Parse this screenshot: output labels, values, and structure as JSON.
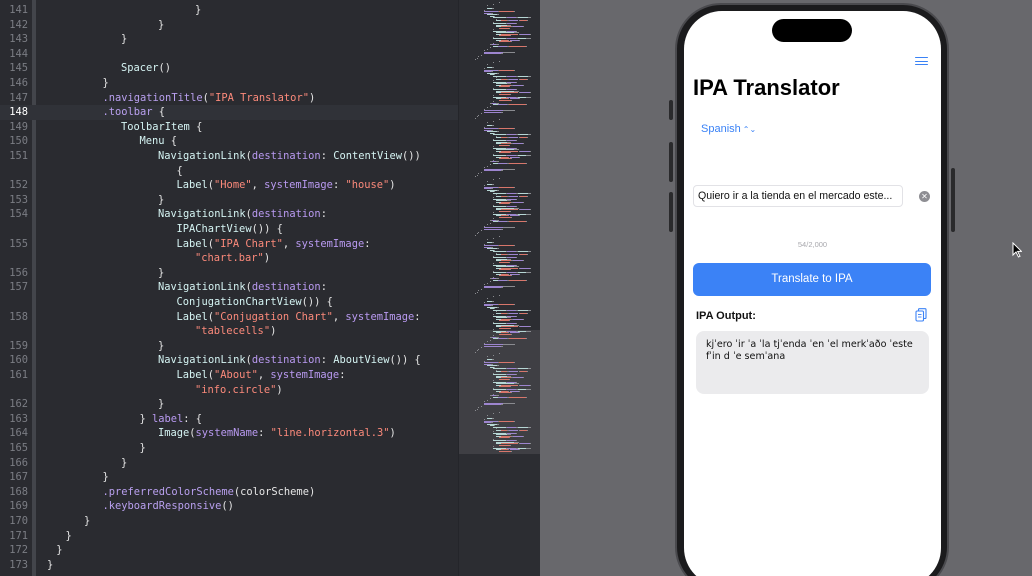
{
  "editor": {
    "current_line": 148,
    "lines": [
      {
        "num": "141",
        "indent": 8,
        "tokens": [
          {
            "t": "}",
            "c": "plain"
          }
        ]
      },
      {
        "num": "142",
        "indent": 6,
        "tokens": [
          {
            "t": "}",
            "c": "plain"
          }
        ]
      },
      {
        "num": "143",
        "indent": 4,
        "tokens": [
          {
            "t": "}",
            "c": "plain"
          }
        ]
      },
      {
        "num": "144",
        "indent": 0,
        "tokens": []
      },
      {
        "num": "145",
        "indent": 4,
        "tokens": [
          {
            "t": "Spacer",
            "c": "type"
          },
          {
            "t": "()",
            "c": "plain"
          }
        ]
      },
      {
        "num": "146",
        "indent": 3,
        "tokens": [
          {
            "t": "}",
            "c": "plain"
          }
        ]
      },
      {
        "num": "147",
        "indent": 3,
        "tokens": [
          {
            "t": ".navigationTitle",
            "c": "fn"
          },
          {
            "t": "(",
            "c": "plain"
          },
          {
            "t": "\"IPA Translator\"",
            "c": "str"
          },
          {
            "t": ")",
            "c": "plain"
          }
        ]
      },
      {
        "num": "148",
        "indent": 3,
        "tokens": [
          {
            "t": ".toolbar",
            "c": "fn"
          },
          {
            "t": " {",
            "c": "plain"
          }
        ]
      },
      {
        "num": "149",
        "indent": 4,
        "tokens": [
          {
            "t": "ToolbarItem",
            "c": "type"
          },
          {
            "t": " {",
            "c": "plain"
          }
        ]
      },
      {
        "num": "150",
        "indent": 5,
        "tokens": [
          {
            "t": "Menu",
            "c": "type"
          },
          {
            "t": " {",
            "c": "plain"
          }
        ]
      },
      {
        "num": "151",
        "indent": 6,
        "tokens": [
          {
            "t": "NavigationLink",
            "c": "type"
          },
          {
            "t": "(",
            "c": "plain"
          },
          {
            "t": "destination",
            "c": "param"
          },
          {
            "t": ": ",
            "c": "plain"
          },
          {
            "t": "ContentView",
            "c": "type"
          },
          {
            "t": "())",
            "c": "plain"
          }
        ]
      },
      {
        "num": "",
        "indent": 7,
        "tokens": [
          {
            "t": "{",
            "c": "plain"
          }
        ]
      },
      {
        "num": "152",
        "indent": 7,
        "tokens": [
          {
            "t": "Label",
            "c": "type"
          },
          {
            "t": "(",
            "c": "plain"
          },
          {
            "t": "\"Home\"",
            "c": "str"
          },
          {
            "t": ", ",
            "c": "plain"
          },
          {
            "t": "systemImage",
            "c": "param"
          },
          {
            "t": ": ",
            "c": "plain"
          },
          {
            "t": "\"house\"",
            "c": "str"
          },
          {
            "t": ")",
            "c": "plain"
          }
        ]
      },
      {
        "num": "153",
        "indent": 6,
        "tokens": [
          {
            "t": "}",
            "c": "plain"
          }
        ]
      },
      {
        "num": "154",
        "indent": 6,
        "tokens": [
          {
            "t": "NavigationLink",
            "c": "type"
          },
          {
            "t": "(",
            "c": "plain"
          },
          {
            "t": "destination",
            "c": "param"
          },
          {
            "t": ":",
            "c": "plain"
          }
        ]
      },
      {
        "num": "",
        "indent": 7,
        "tokens": [
          {
            "t": "IPAChartView",
            "c": "type"
          },
          {
            "t": "()) {",
            "c": "plain"
          }
        ]
      },
      {
        "num": "155",
        "indent": 7,
        "tokens": [
          {
            "t": "Label",
            "c": "type"
          },
          {
            "t": "(",
            "c": "plain"
          },
          {
            "t": "\"IPA Chart\"",
            "c": "str"
          },
          {
            "t": ", ",
            "c": "plain"
          },
          {
            "t": "systemImage",
            "c": "param"
          },
          {
            "t": ":",
            "c": "plain"
          }
        ]
      },
      {
        "num": "",
        "indent": 8,
        "tokens": [
          {
            "t": "\"chart.bar\"",
            "c": "str"
          },
          {
            "t": ")",
            "c": "plain"
          }
        ]
      },
      {
        "num": "156",
        "indent": 6,
        "tokens": [
          {
            "t": "}",
            "c": "plain"
          }
        ]
      },
      {
        "num": "157",
        "indent": 6,
        "tokens": [
          {
            "t": "NavigationLink",
            "c": "type"
          },
          {
            "t": "(",
            "c": "plain"
          },
          {
            "t": "destination",
            "c": "param"
          },
          {
            "t": ":",
            "c": "plain"
          }
        ]
      },
      {
        "num": "",
        "indent": 7,
        "tokens": [
          {
            "t": "ConjugationChartView",
            "c": "type"
          },
          {
            "t": "()) {",
            "c": "plain"
          }
        ]
      },
      {
        "num": "158",
        "indent": 7,
        "tokens": [
          {
            "t": "Label",
            "c": "type"
          },
          {
            "t": "(",
            "c": "plain"
          },
          {
            "t": "\"Conjugation Chart\"",
            "c": "str"
          },
          {
            "t": ", ",
            "c": "plain"
          },
          {
            "t": "systemImage",
            "c": "param"
          },
          {
            "t": ":",
            "c": "plain"
          }
        ]
      },
      {
        "num": "",
        "indent": 8,
        "tokens": [
          {
            "t": "\"tablecells\"",
            "c": "str"
          },
          {
            "t": ")",
            "c": "plain"
          }
        ]
      },
      {
        "num": "159",
        "indent": 6,
        "tokens": [
          {
            "t": "}",
            "c": "plain"
          }
        ]
      },
      {
        "num": "160",
        "indent": 6,
        "tokens": [
          {
            "t": "NavigationLink",
            "c": "type"
          },
          {
            "t": "(",
            "c": "plain"
          },
          {
            "t": "destination",
            "c": "param"
          },
          {
            "t": ": ",
            "c": "plain"
          },
          {
            "t": "AboutView",
            "c": "type"
          },
          {
            "t": "()) {",
            "c": "plain"
          }
        ]
      },
      {
        "num": "161",
        "indent": 7,
        "tokens": [
          {
            "t": "Label",
            "c": "type"
          },
          {
            "t": "(",
            "c": "plain"
          },
          {
            "t": "\"About\"",
            "c": "str"
          },
          {
            "t": ", ",
            "c": "plain"
          },
          {
            "t": "systemImage",
            "c": "param"
          },
          {
            "t": ":",
            "c": "plain"
          }
        ]
      },
      {
        "num": "",
        "indent": 8,
        "tokens": [
          {
            "t": "\"info.circle\"",
            "c": "str"
          },
          {
            "t": ")",
            "c": "plain"
          }
        ]
      },
      {
        "num": "162",
        "indent": 6,
        "tokens": [
          {
            "t": "}",
            "c": "plain"
          }
        ]
      },
      {
        "num": "163",
        "indent": 5,
        "tokens": [
          {
            "t": "} ",
            "c": "plain"
          },
          {
            "t": "label",
            "c": "param"
          },
          {
            "t": ": {",
            "c": "plain"
          }
        ]
      },
      {
        "num": "164",
        "indent": 6,
        "tokens": [
          {
            "t": "Image",
            "c": "type"
          },
          {
            "t": "(",
            "c": "plain"
          },
          {
            "t": "systemName",
            "c": "param"
          },
          {
            "t": ": ",
            "c": "plain"
          },
          {
            "t": "\"line.horizontal.3\"",
            "c": "str"
          },
          {
            "t": ")",
            "c": "plain"
          }
        ]
      },
      {
        "num": "165",
        "indent": 5,
        "tokens": [
          {
            "t": "}",
            "c": "plain"
          }
        ]
      },
      {
        "num": "166",
        "indent": 4,
        "tokens": [
          {
            "t": "}",
            "c": "plain"
          }
        ]
      },
      {
        "num": "167",
        "indent": 3,
        "tokens": [
          {
            "t": "}",
            "c": "plain"
          }
        ]
      },
      {
        "num": "168",
        "indent": 3,
        "tokens": [
          {
            "t": ".preferredColorScheme",
            "c": "fn"
          },
          {
            "t": "(colorScheme)",
            "c": "plain"
          }
        ]
      },
      {
        "num": "169",
        "indent": 3,
        "tokens": [
          {
            "t": ".keyboardResponsive",
            "c": "fn"
          },
          {
            "t": "()",
            "c": "plain"
          }
        ]
      },
      {
        "num": "170",
        "indent": 2,
        "tokens": [
          {
            "t": "}",
            "c": "plain"
          }
        ]
      },
      {
        "num": "171",
        "indent": 1,
        "tokens": [
          {
            "t": "}",
            "c": "plain"
          }
        ]
      },
      {
        "num": "172",
        "indent": 0.5,
        "tokens": [
          {
            "t": "}",
            "c": "plain"
          }
        ]
      },
      {
        "num": "173",
        "indent": 0,
        "tokens": [
          {
            "t": "}",
            "c": "plain"
          }
        ]
      }
    ]
  },
  "colors": {
    "accent": "#3b82f6",
    "editor_bg": "#2a2b30",
    "string": "#fc8a7b",
    "function": "#b9a0ef",
    "type": "#d5f4f3"
  },
  "app": {
    "nav_title": "IPA Translator",
    "language": "Spanish",
    "input_text": "Quiero ir a la tienda en el mercado este...",
    "char_count": "54/2,000",
    "translate_button": "Translate to IPA",
    "output_label": "IPA Output:",
    "output_text": "kjˈero ˈir ˈa ˈla tjˈenda ˈen ˈel merkˈaðo ˈeste fˈin d ˈe semˈana",
    "icons": {
      "menu": "line-horizontal-3-icon",
      "clear": "clear-icon",
      "copy": "copy-icon"
    }
  }
}
